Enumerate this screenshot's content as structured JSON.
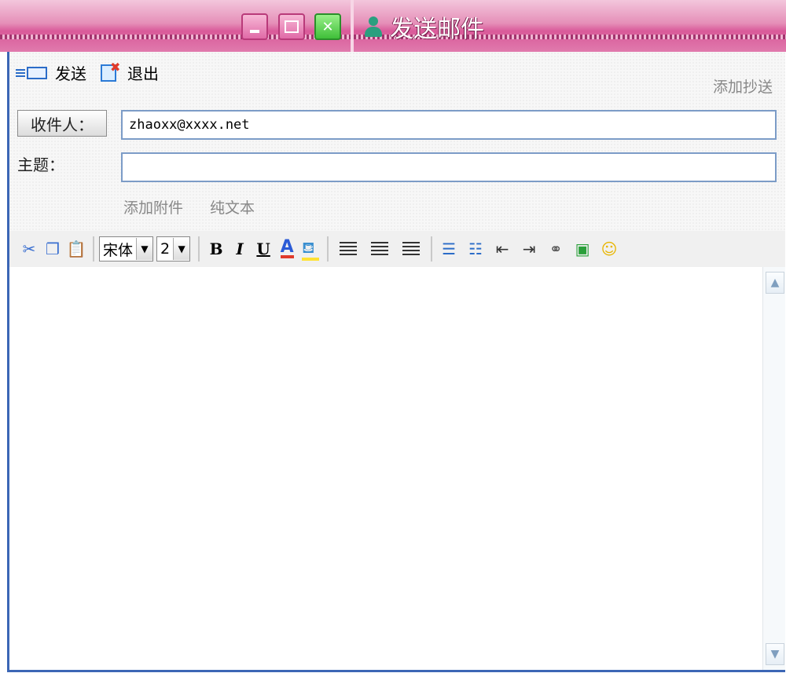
{
  "window": {
    "title": "发送邮件"
  },
  "toolbar": {
    "send_label": "发送",
    "exit_label": "退出",
    "add_cc": "添加抄送"
  },
  "form": {
    "to_label": "收件人：",
    "to_value": "zhaoxx@xxxx.net",
    "subject_label": "主题：",
    "subject_value": "",
    "add_attachment": "添加附件",
    "plain_text": "纯文本"
  },
  "editor_toolbar": {
    "font_name": "宋体",
    "font_size": "2",
    "bold": "B",
    "italic": "I",
    "underline": "U",
    "font_color": "A"
  },
  "icons": {
    "accent": "#3b66b5",
    "titlebar": "#d95a99"
  }
}
